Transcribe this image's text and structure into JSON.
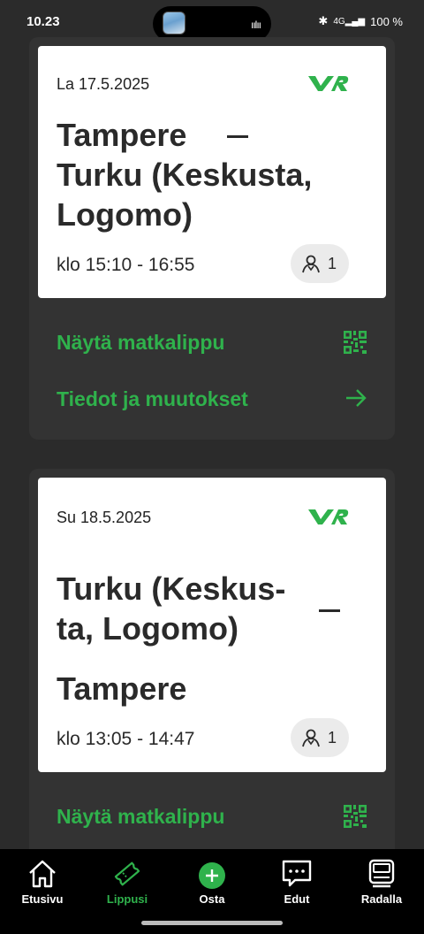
{
  "status_bar": {
    "time": "10.23",
    "battery": "100 %",
    "network": "4G",
    "icons": [
      "bluetooth-icon",
      "signal-icon"
    ]
  },
  "trips": [
    {
      "date": "La 17.5.2025",
      "logo_text": "VR",
      "route_from_lines": [
        "Tampere"
      ],
      "route_to_lines": [
        "Turku (Keskusta,",
        "Logomo)"
      ],
      "time": "klo 15:10 - 16:55",
      "passengers": "1",
      "actions": [
        {
          "label": "Näytä matkalippu",
          "icon": "qr-code-icon"
        },
        {
          "label": "Tiedot ja muutokset",
          "icon": "arrow-right-icon"
        }
      ]
    },
    {
      "date": "Su 18.5.2025",
      "logo_text": "VR",
      "route_from_lines": [
        "Turku (Keskus-",
        "ta, Logomo)"
      ],
      "route_to_lines": [
        "Tampere"
      ],
      "time": "klo 13:05 - 14:47",
      "passengers": "1",
      "actions": [
        {
          "label": "Näytä matkalippu",
          "icon": "qr-code-icon"
        }
      ]
    }
  ],
  "bottom_nav": [
    {
      "label": "Etusivu",
      "icon": "home-icon",
      "active": false
    },
    {
      "label": "Lippusi",
      "icon": "ticket-icon",
      "active": true
    },
    {
      "label": "Osta",
      "icon": "plus-circle-icon",
      "active": false
    },
    {
      "label": "Edut",
      "icon": "chat-bubble-icon",
      "active": false
    },
    {
      "label": "Radalla",
      "icon": "train-icon",
      "active": false
    }
  ],
  "colors": {
    "accent": "#2fb24c",
    "background": "#2b2b2b",
    "panel": "#333333",
    "card": "#ffffff"
  }
}
